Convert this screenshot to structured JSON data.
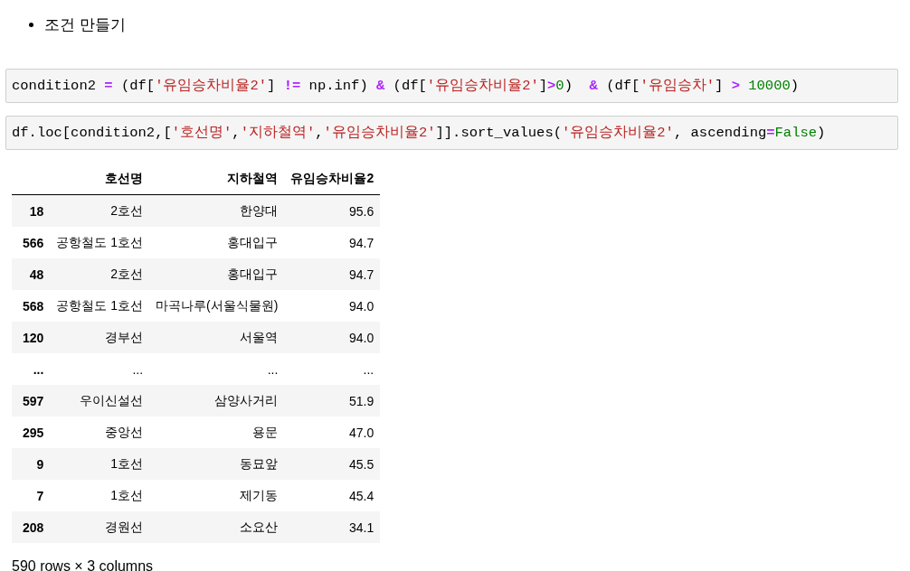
{
  "bullet": {
    "text": "조건 만들기"
  },
  "code_cells": [
    {
      "tokens": [
        {
          "kind": "plain",
          "text": "condition2 "
        },
        {
          "kind": "operator",
          "text": "="
        },
        {
          "kind": "plain",
          "text": " (df["
        },
        {
          "kind": "string",
          "text": "'유임승차비율2'"
        },
        {
          "kind": "plain",
          "text": "] "
        },
        {
          "kind": "operator",
          "text": "!="
        },
        {
          "kind": "plain",
          "text": " np.inf) "
        },
        {
          "kind": "operator",
          "text": "&"
        },
        {
          "kind": "plain",
          "text": " (df["
        },
        {
          "kind": "string",
          "text": "'유임승차비율2'"
        },
        {
          "kind": "plain",
          "text": "]"
        },
        {
          "kind": "operator",
          "text": ">"
        },
        {
          "kind": "number",
          "text": "0"
        },
        {
          "kind": "plain",
          "text": ")  "
        },
        {
          "kind": "operator",
          "text": "&"
        },
        {
          "kind": "plain",
          "text": " (df["
        },
        {
          "kind": "string",
          "text": "'유임승차'"
        },
        {
          "kind": "plain",
          "text": "] "
        },
        {
          "kind": "operator",
          "text": ">"
        },
        {
          "kind": "number",
          "text": " 10000"
        },
        {
          "kind": "plain",
          "text": ")"
        }
      ]
    },
    {
      "tokens": [
        {
          "kind": "plain",
          "text": "df.loc[condition2,["
        },
        {
          "kind": "string",
          "text": "'호선명'"
        },
        {
          "kind": "plain",
          "text": ","
        },
        {
          "kind": "string",
          "text": "'지하철역'"
        },
        {
          "kind": "plain",
          "text": ","
        },
        {
          "kind": "string",
          "text": "'유임승차비율2'"
        },
        {
          "kind": "plain",
          "text": "]].sort_values("
        },
        {
          "kind": "string",
          "text": "'유임승차비율2'"
        },
        {
          "kind": "plain",
          "text": ", ascending"
        },
        {
          "kind": "operator",
          "text": "="
        },
        {
          "kind": "keyword",
          "text": "False"
        },
        {
          "kind": "plain",
          "text": ")"
        }
      ]
    }
  ],
  "table": {
    "columns": [
      "호선명",
      "지하철역",
      "유임승차비율2"
    ],
    "rows": [
      {
        "index": "18",
        "cells": [
          "2호선",
          "한양대",
          "95.6"
        ]
      },
      {
        "index": "566",
        "cells": [
          "공항철도 1호선",
          "홍대입구",
          "94.7"
        ]
      },
      {
        "index": "48",
        "cells": [
          "2호선",
          "홍대입구",
          "94.7"
        ]
      },
      {
        "index": "568",
        "cells": [
          "공항철도 1호선",
          "마곡나루(서울식물원)",
          "94.0"
        ]
      },
      {
        "index": "120",
        "cells": [
          "경부선",
          "서울역",
          "94.0"
        ]
      },
      {
        "index": "...",
        "cells": [
          "...",
          "...",
          "..."
        ]
      },
      {
        "index": "597",
        "cells": [
          "우이신설선",
          "삼양사거리",
          "51.9"
        ]
      },
      {
        "index": "295",
        "cells": [
          "중앙선",
          "용문",
          "47.0"
        ]
      },
      {
        "index": "9",
        "cells": [
          "1호선",
          "동묘앞",
          "45.5"
        ]
      },
      {
        "index": "7",
        "cells": [
          "1호선",
          "제기동",
          "45.4"
        ]
      },
      {
        "index": "208",
        "cells": [
          "경원선",
          "소요산",
          "34.1"
        ]
      }
    ]
  },
  "footer": "590 rows × 3 columns"
}
